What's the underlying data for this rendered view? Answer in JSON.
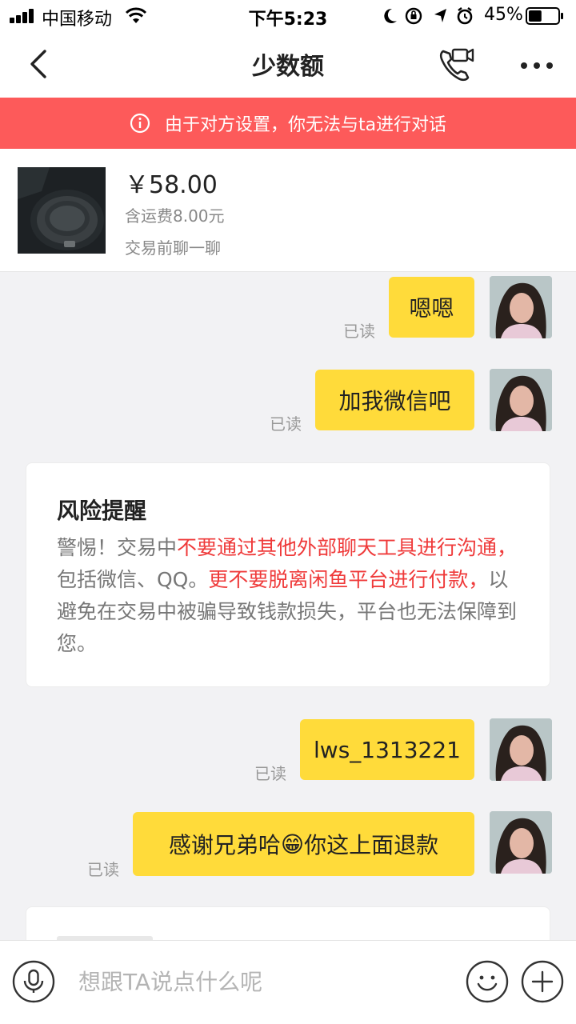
{
  "status_bar": {
    "carrier": "中国移动",
    "time": "下午5:23",
    "battery_percent": "45%",
    "battery_level": 0.45
  },
  "nav": {
    "title": "少数额"
  },
  "banner": {
    "text": "由于对方设置，你无法与ta进行对话"
  },
  "product": {
    "price": "￥58.00",
    "shipping": "含运费8.00元",
    "note": "交易前聊一聊"
  },
  "messages": [
    {
      "text": "嗯嗯",
      "status": "已读"
    },
    {
      "text": "加我微信吧",
      "status": "已读"
    },
    {
      "text": "lws_1313221",
      "status": "已读"
    },
    {
      "text_before": "感谢兄弟哈",
      "emoji": "😁",
      "text_after": "你这上面退款",
      "status": "已读"
    }
  ],
  "risk_notice": {
    "title": "风险提醒",
    "segments": [
      {
        "text": "警惕！交易中",
        "highlight": false
      },
      {
        "text": "不要通过其他外部聊天工具进行沟通，",
        "highlight": true
      },
      {
        "text": "包括微信、QQ。",
        "highlight": false
      },
      {
        "text": "更不要脱离闲鱼平台进行付款，",
        "highlight": true
      },
      {
        "text": "以避免在交易中被骗导致钱款损失，平台也无法保障到您。",
        "highlight": false
      }
    ]
  },
  "input": {
    "placeholder": "想跟TA说点什么呢"
  },
  "colors": {
    "banner": "#fd5a5a",
    "bubble": "#ffdb3a",
    "highlight": "#ef3a3a"
  }
}
